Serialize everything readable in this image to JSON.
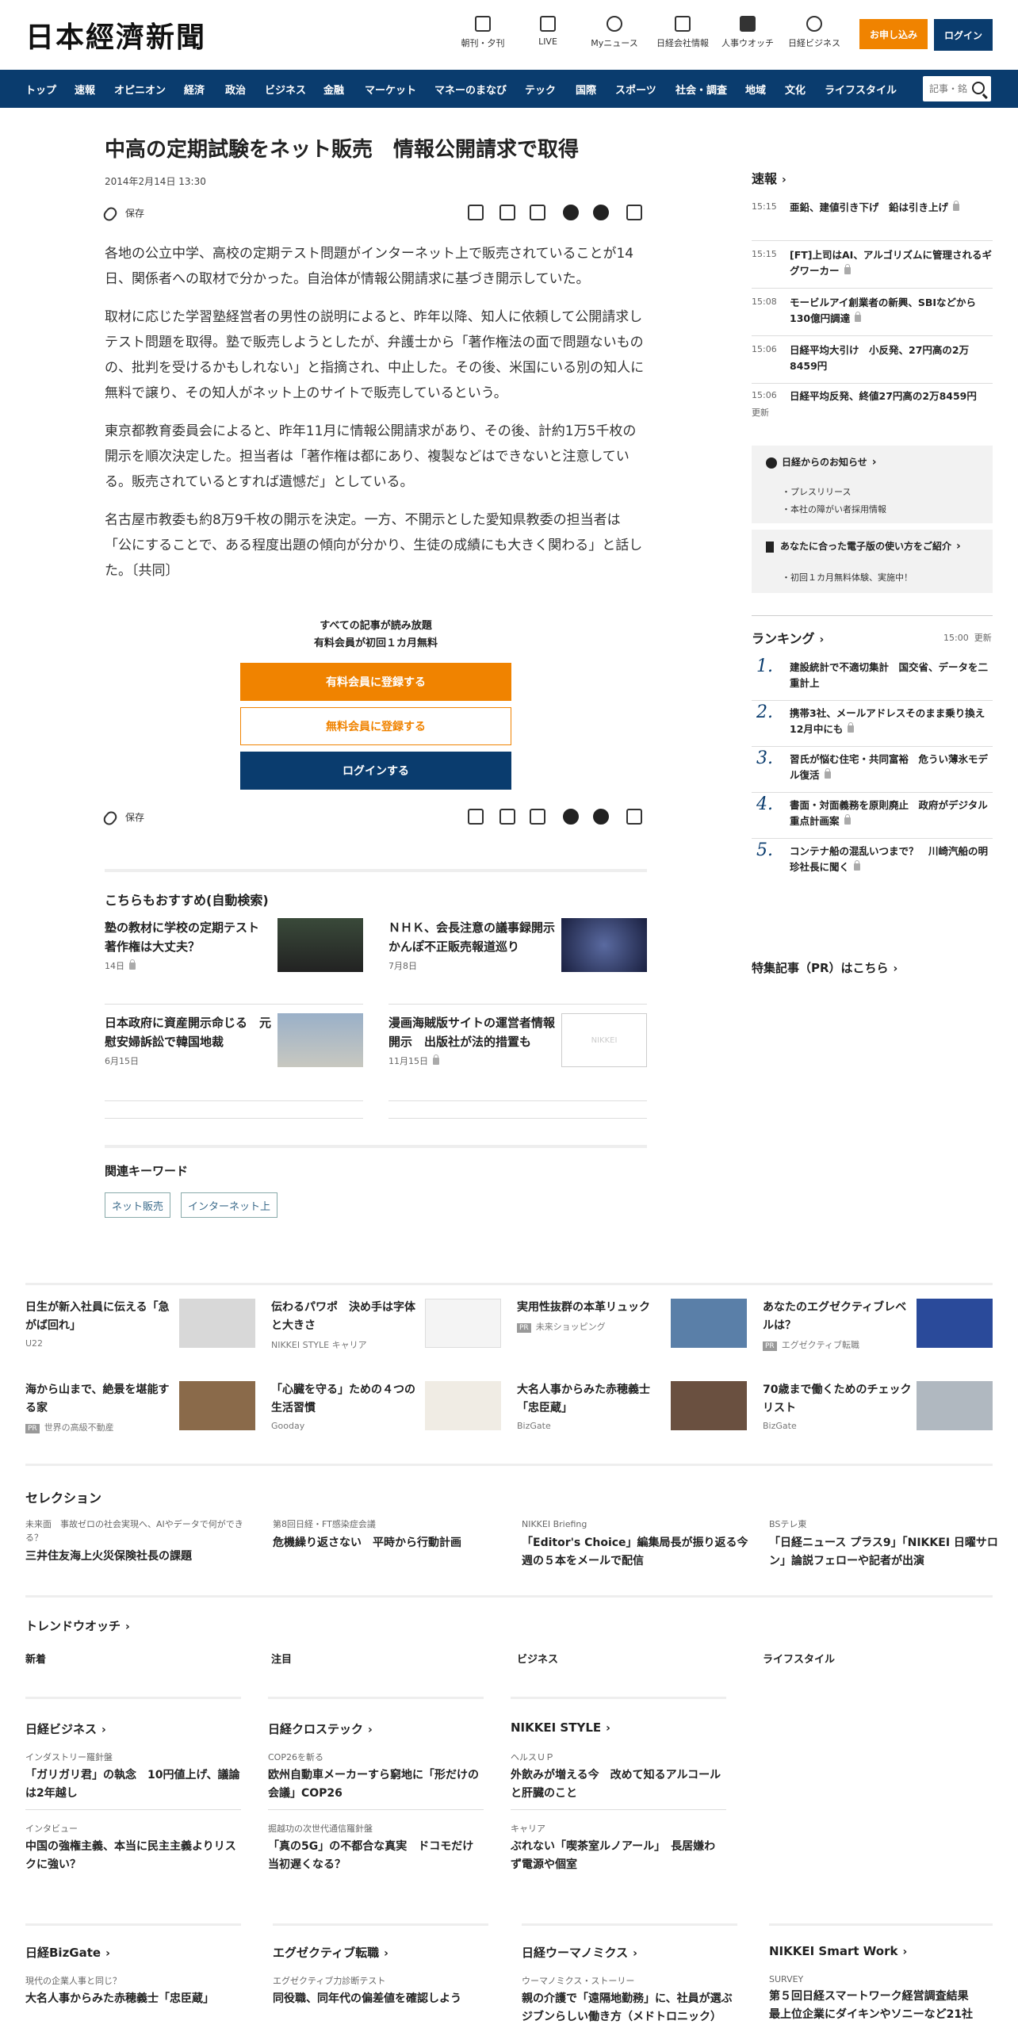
{
  "header": {
    "logo": "日本經濟新聞",
    "icons": [
      {
        "label": "朝刊・夕刊",
        "icon": "newspaper-icon"
      },
      {
        "label": "LIVE",
        "icon": "video-icon"
      },
      {
        "label": "Myニュース",
        "icon": "person-icon"
      },
      {
        "label": "日経会社情報",
        "icon": "chart-icon"
      },
      {
        "label": "人事ウオッチ",
        "icon": "search-people-icon"
      },
      {
        "label": "日経ビジネス",
        "icon": "compass-icon"
      }
    ],
    "apply": "お申し込み",
    "login": "ログイン"
  },
  "nav": {
    "items": [
      "トップ",
      "速報",
      "オピニオン",
      "経済",
      "政治",
      "ビジネス",
      "金融",
      "マーケット",
      "マネーのまなび",
      "テック",
      "国際",
      "スポーツ",
      "社会・調査",
      "地域",
      "文化",
      "ライフスタイル"
    ],
    "search_placeholder": "記事・銘柄"
  },
  "article": {
    "title": "中高の定期試験をネット販売　情報公開請求で取得",
    "date": "2014年2月14日 13:30",
    "save": "保存",
    "paragraphs": [
      "各地の公立中学、高校の定期テスト問題がインターネット上で販売されていることが14日、関係者への取材で分かった。自治体が情報公開請求に基づき開示していた。",
      "取材に応じた学習塾経営者の男性の説明によると、昨年以降、知人に依頼して公開請求しテスト問題を取得。塾で販売しようとしたが、弁護士から「著作権法の面で問題ないものの、批判を受けるかもしれない」と指摘され、中止した。その後、米国にいる別の知人に無料で譲り、その知人がネット上のサイトで販売しているという。",
      "東京都教育委員会によると、昨年11月に情報公開請求があり、その後、計約1万5千枚の開示を順次決定した。担当者は「著作権は都にあり、複製などはできないと注意している。販売されているとすれば遺憾だ」としている。",
      "名古屋市教委も約8万9千枚の開示を決定。一方、不開示とした愛知県教委の担当者は「公にすることで、ある程度出題の傾向が分かり、生徒の成績にも大きく関わる」と話した。〔共同〕"
    ]
  },
  "paywall": {
    "line1": "すべての記事が読み放題",
    "line2": "有料会員が初回１カ月無料",
    "paid": "有料会員に登録する",
    "free": "無料会員に登録する",
    "login": "ログインする"
  },
  "recommend": {
    "heading": "こちらもおすすめ(自動検索)",
    "items": [
      {
        "title": "塾の教材に学校の定期テスト　著作権は大丈夫？",
        "date": "14日",
        "locked": true
      },
      {
        "title": "ＮＨＫ、会長注意の議事録開示　かんぽ不正販売報道巡り",
        "date": "7月8日",
        "locked": false
      },
      {
        "title": "日本政府に資産開示命じる　元慰安婦訴訟で韓国地裁",
        "date": "6月15日",
        "locked": false
      },
      {
        "title": "漫画海賊版サイトの運営者情報開示　出版社が法的措置も",
        "date": "11月15日",
        "locked": true
      }
    ],
    "placeholder_logo": "NIKKEI"
  },
  "keywords": {
    "heading": "関連キーワード",
    "items": [
      "ネット販売",
      "インターネット上"
    ]
  },
  "sidebar": {
    "flash_heading": "速報",
    "flash": [
      {
        "time": "15:15",
        "text": "亜鉛、建値引き下げ　鉛は引き上げ",
        "locked": true
      },
      {
        "time": "15:15",
        "text": "[FT]上司はAI、アルゴリズムに管理されるギグワーカー",
        "locked": true
      },
      {
        "time": "15:08",
        "text": "モービルアイ創業者の新興、SBIなどから130億円調達",
        "locked": true
      },
      {
        "time": "15:06",
        "text": "日経平均大引け　小反発、27円高の2万8459円",
        "locked": false
      },
      {
        "time": "15:06",
        "text": "日経平均反発、終値27円高の2万8459円",
        "locked": false
      }
    ],
    "flash_more": "更新",
    "notice_heading": "日経からのお知らせ",
    "notice_items": [
      "プレスリリース",
      "本社の障がい者採用情報"
    ],
    "guide_heading": "あなたに合った電子版の使い方をご紹介",
    "guide_items": [
      "初回１カ月無料体験、実施中！"
    ],
    "ranking_heading": "ランキング",
    "ranking_time": "15:00",
    "ranking_update": "更新",
    "ranking": [
      {
        "no": "1.",
        "text": "建設統計で不適切集計　国交省、データを二重計上",
        "locked": false
      },
      {
        "no": "2.",
        "text": "携帯3社、メールアドレスそのまま乗り換え12月中にも",
        "locked": true
      },
      {
        "no": "3.",
        "text": "習氏が悩む住宅・共同富裕　危うい薄氷モデル復活",
        "locked": true
      },
      {
        "no": "4.",
        "text": "書面・対面義務を原則廃止　政府がデジタル重点計画案",
        "locked": true
      },
      {
        "no": "5.",
        "text": "コンテナ船の混乱いつまで？　川崎汽船の明珍社長に聞く",
        "locked": true
      }
    ],
    "pr_heading": "特集記事（PR）はこちら"
  },
  "ads": [
    {
      "title": "日生が新入社員に伝える「急がば回れ」",
      "source": "U22",
      "pr": false,
      "color": "#d8d8d8"
    },
    {
      "title": "伝わるパワポ　決め手は字体と大きさ",
      "source": "NIKKEI STYLE キャリア",
      "pr": false,
      "color": "#f4f4f4"
    },
    {
      "title": "実用性抜群の本革リュック",
      "source": "未来ショッピング",
      "pr": true,
      "color": "#5a7fa8"
    },
    {
      "title": "あなたのエグゼクティブレベルは？",
      "source": "エグゼクティブ転職",
      "pr": true,
      "color": "#2a4a9a"
    },
    {
      "title": "海から山まで、絶景を堪能する家",
      "source": "世界の高級不動産",
      "pr": true,
      "color": "#8a6a4a"
    },
    {
      "title": "「心臓を守る」ための４つの生活習慣",
      "source": "Gooday",
      "pr": false,
      "color": "#f0ece4"
    },
    {
      "title": "大名人事からみた赤穂義士「忠臣蔵」",
      "source": "BizGate",
      "pr": false,
      "color": "#6a5040"
    },
    {
      "title": "70歳まで働くためのチェックリスト",
      "source": "BizGate",
      "pr": false,
      "color": "#b0b8c0"
    }
  ],
  "selection": {
    "heading": "セレクション",
    "items": [
      {
        "kicker": "未来面　事故ゼロの社会実現へ、AIやデータで何ができる？",
        "title": "三井住友海上火災保険社長の課題"
      },
      {
        "kicker": "第8回日経・FT感染症会議",
        "title": "危機繰り返さない　平時から行動計画"
      },
      {
        "kicker": "NIKKEI Briefing",
        "title": "「Editor's Choice」編集局長が振り返る今週の５本をメールで配信"
      },
      {
        "kicker": "BSテレ東",
        "title": "「日経ニュース プラス9」「NIKKEI 日曜サロン」論説フェローや記者が出演"
      }
    ]
  },
  "trend": {
    "heading": "トレンドウオッチ",
    "cols": [
      "新着",
      "注目",
      "ビジネス",
      "ライフスタイル"
    ]
  },
  "media": [
    {
      "heading": "日経ビジネス",
      "items": [
        {
          "kicker": "インダストリー羅針盤",
          "title": "「ガリガリ君」の執念　10円値上げ、議論は2年越し"
        },
        {
          "kicker": "インタビュー",
          "title": "中国の強権主義、本当に民主主義よりリスクに強い？"
        }
      ]
    },
    {
      "heading": "日経クロステック",
      "items": [
        {
          "kicker": "COP26を斬る",
          "title": "欧州自動車メーカーすら窮地に「形だけの会議」COP26"
        },
        {
          "kicker": "掘越功の次世代通信羅針盤",
          "title": "「真の5G」の不都合な真実　ドコモだけ当初遅くなる？"
        }
      ]
    },
    {
      "heading": "NIKKEI STYLE",
      "items": [
        {
          "kicker": "ヘルスＵＰ",
          "title": "外飲みが増える今　改めて知るアルコールと肝臓のこと"
        },
        {
          "kicker": "キャリア",
          "title": "ぶれない「喫茶室ルノアール」　長居嫌わず電源や個室"
        }
      ]
    }
  ],
  "media2": [
    {
      "heading": "日経BizGate",
      "kicker": "現代の企業人事と同じ？",
      "title": "大名人事からみた赤穂義士「忠臣蔵」"
    },
    {
      "heading": "エグゼクティブ転職",
      "kicker": "エグゼクティブ力診断テスト",
      "title": "同役職、同年代の偏差値を確認しよう"
    },
    {
      "heading": "日経ウーマノミクス",
      "kicker": "ウーマノミクス・ストーリー",
      "title": "親の介護で「遠隔地勤務」に、社員が選ぶジブンらしい働き方（メドトロニック）"
    },
    {
      "heading": "NIKKEI Smart Work",
      "kicker": "SURVEY",
      "title": "第５回日経スマートワーク経営調査結果　最上位企業にダイキンやソニーなど21社"
    }
  ],
  "colors": {
    "navy": "#0a3c6e",
    "orange": "#f08300"
  }
}
